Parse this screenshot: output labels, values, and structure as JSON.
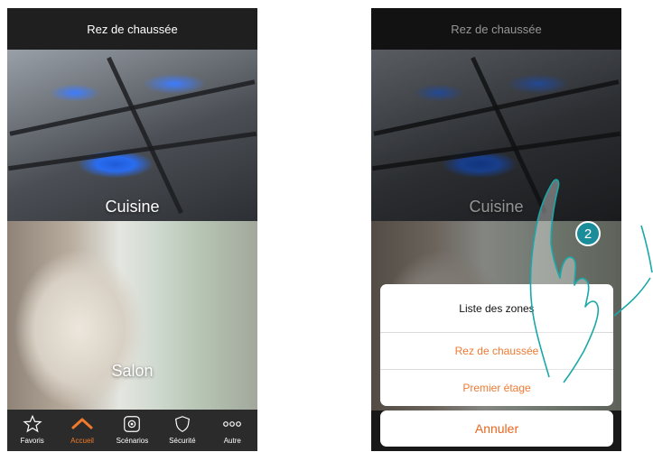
{
  "colors": {
    "accent": "#ee7a33",
    "step_badge": "#1a8c9a",
    "hand_outline": "#1aa7a8"
  },
  "left_screen": {
    "header": {
      "title": "Rez de chaussée"
    },
    "rooms": [
      {
        "label": "Cuisine"
      },
      {
        "label": "Salon"
      }
    ],
    "nav": [
      {
        "label": "Favoris",
        "icon": "star-icon",
        "active": false
      },
      {
        "label": "Accueil",
        "icon": "home-icon",
        "active": true
      },
      {
        "label": "Scénarios",
        "icon": "scenario-gear-icon",
        "active": false
      },
      {
        "label": "Sécurité",
        "icon": "shield-icon",
        "active": false
      },
      {
        "label": "Autre",
        "icon": "more-dots-icon",
        "active": false
      }
    ]
  },
  "right_screen": {
    "header": {
      "title": "Rez de chaussée"
    },
    "rooms": [
      {
        "label": "Cuisine"
      }
    ],
    "zone_sheet": {
      "title": "Liste des zones",
      "options": [
        "Rez de chaussée",
        "Premier étage"
      ],
      "cancel_label": "Annuler"
    }
  },
  "step_marker": {
    "number": "2"
  }
}
